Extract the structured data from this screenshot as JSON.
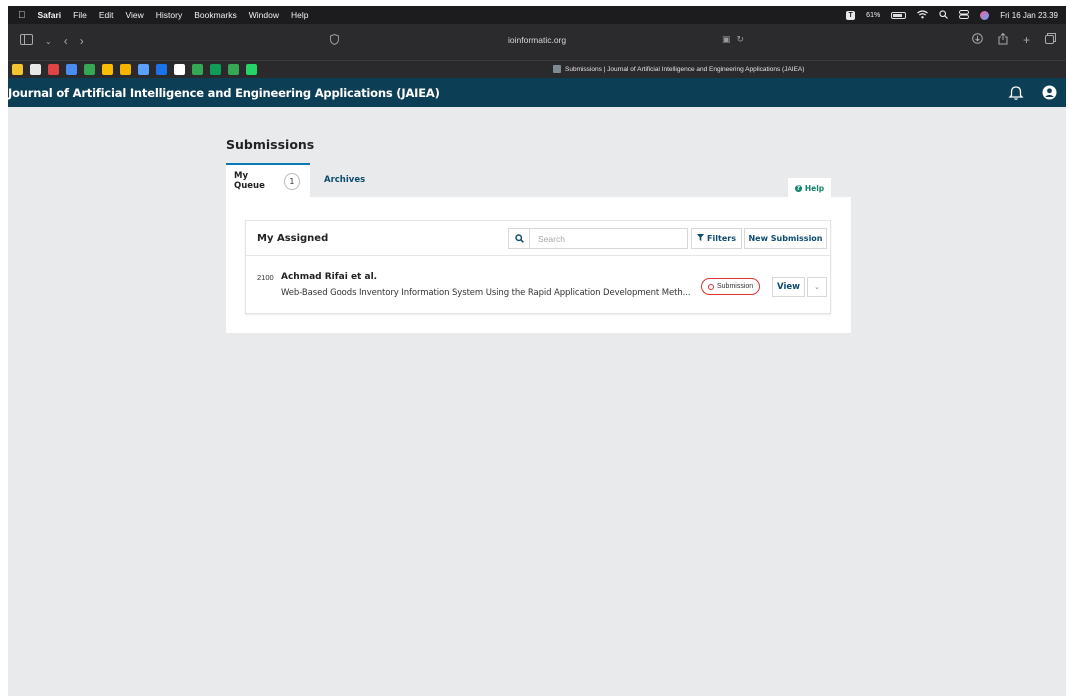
{
  "menubar": {
    "app": "Safari",
    "items": [
      "File",
      "Edit",
      "View",
      "History",
      "Bookmarks",
      "Window",
      "Help"
    ],
    "battery": "61%",
    "datetime": "Fri 16 Jan 23.39"
  },
  "browser": {
    "url": "ioinformatic.org",
    "tab_title": "Submissions | Journal of Artificial Intelligence and Engineering Applications (JAIEA)",
    "bookmark_colors": [
      "#f4c430",
      "#e8e8e8",
      "#e04444",
      "#4a8df0",
      "#34a853",
      "#fbbc05",
      "#f4b400",
      "#5aa0ff",
      "#1a73e8",
      "#ffffff",
      "#34a853",
      "#0f9d58",
      "#34a853",
      "#25d366"
    ]
  },
  "site": {
    "title": "Journal of Artificial Intelligence and Engineering Applications (JAIEA)"
  },
  "page": {
    "title": "Submissions",
    "tabs": [
      {
        "label": "My Queue",
        "count": "1"
      },
      {
        "label": "Archives"
      }
    ],
    "help_label": "Help"
  },
  "list": {
    "title": "My Assigned",
    "search_placeholder": "Search",
    "filters_label": "Filters",
    "new_submission_label": "New Submission",
    "items": [
      {
        "id": "2100",
        "author": "Achmad Rifai et al.",
        "title": "Web-Based Goods Inventory Information System Using the Rapid Application Development Meth...",
        "stage": "Submission",
        "view_label": "View"
      }
    ]
  },
  "colors": {
    "header_bg": "#0c3e55",
    "link": "#0c4a6e",
    "help_green": "#11836b",
    "stage_red": "#dd3333",
    "active_tab": "#0c7bb3"
  }
}
